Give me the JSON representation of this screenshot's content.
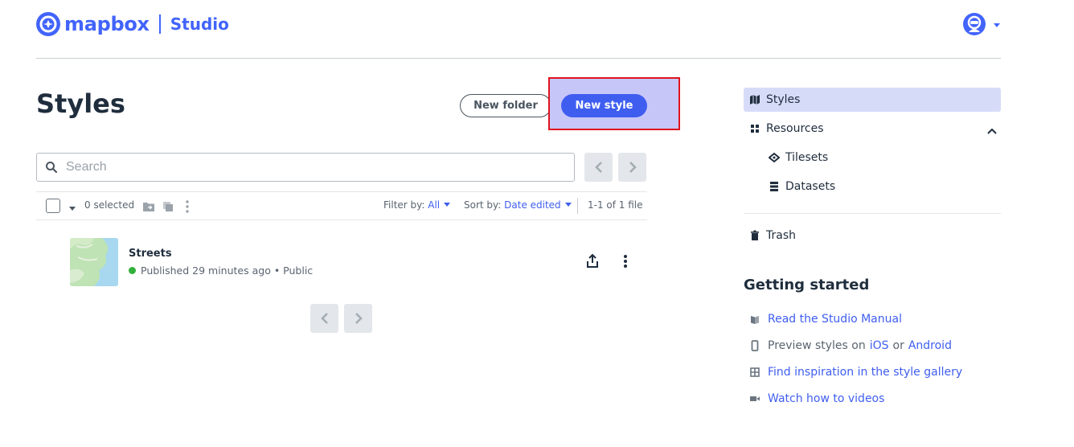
{
  "header": {
    "logo_text": "mapbox",
    "product": "Studio",
    "brand_color": "#4264fb"
  },
  "main": {
    "title": "Styles",
    "new_folder_label": "New folder",
    "new_style_label": "New style",
    "search_placeholder": "Search",
    "toolbar": {
      "selected_count": "0 selected",
      "filter_label": "Filter by:",
      "filter_value": "All",
      "sort_label": "Sort by:",
      "sort_value": "Date edited",
      "range": "1-1 of 1 file"
    },
    "styles": [
      {
        "name": "Streets",
        "status": "Published 29 minutes ago • Public",
        "status_color": "#31b13b"
      }
    ]
  },
  "sidebar": {
    "items": [
      {
        "label": "Styles",
        "icon": "map-icon",
        "active": true
      },
      {
        "label": "Resources",
        "icon": "grid-icon"
      },
      {
        "label": "Tilesets",
        "icon": "layers-icon"
      },
      {
        "label": "Datasets",
        "icon": "database-icon"
      },
      {
        "label": "Trash",
        "icon": "trash-icon"
      }
    ],
    "getting_started": {
      "title": "Getting started",
      "manual": "Read the Studio Manual",
      "preview_prefix": "Preview styles on",
      "ios": "iOS",
      "or": "or",
      "android": "Android",
      "gallery": "Find inspiration in the style gallery",
      "videos": "Watch how to videos"
    }
  },
  "colors": {
    "accent": "#3f5ef0",
    "highlight_fill": "#c7c6f9",
    "highlight_border": "#e0141e",
    "active_bg": "#d6dcf8"
  }
}
